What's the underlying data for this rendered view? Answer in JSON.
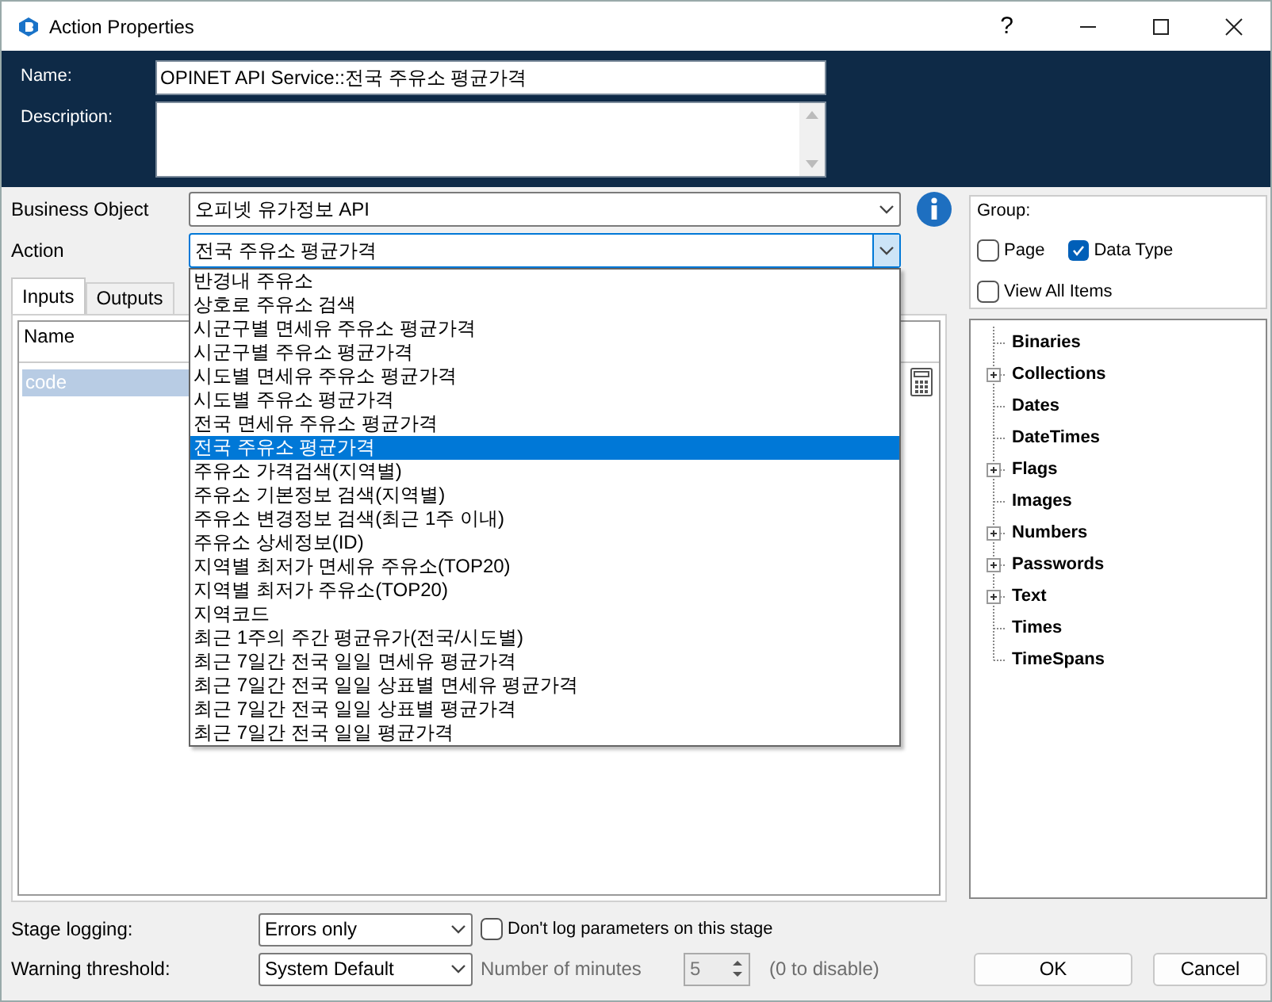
{
  "window": {
    "title": "Action Properties",
    "help": "?"
  },
  "header": {
    "name_label": "Name:",
    "name_value": "OPINET API Service::전국 주유소 평균가격",
    "description_label": "Description:"
  },
  "business_object": {
    "label": "Business Object",
    "value": "오피넷 유가정보 API"
  },
  "action": {
    "label": "Action",
    "value": "전국 주유소 평균가격",
    "expanded": true,
    "options": [
      {
        "label": "반경내 주유소",
        "selected": false
      },
      {
        "label": "상호로 주유소 검색",
        "selected": false
      },
      {
        "label": "시군구별 면세유 주유소 평균가격",
        "selected": false
      },
      {
        "label": "시군구별 주유소 평균가격",
        "selected": false
      },
      {
        "label": "시도별 면세유 주유소 평균가격",
        "selected": false
      },
      {
        "label": "시도별 주유소 평균가격",
        "selected": false
      },
      {
        "label": "전국 면세유 주유소 평균가격",
        "selected": false
      },
      {
        "label": "전국 주유소 평균가격",
        "selected": true
      },
      {
        "label": "주유소 가격검색(지역별)",
        "selected": false
      },
      {
        "label": "주유소 기본정보 검색(지역별)",
        "selected": false
      },
      {
        "label": "주유소 변경정보 검색(최근 1주 이내)",
        "selected": false
      },
      {
        "label": "주유소 상세정보(ID)",
        "selected": false
      },
      {
        "label": "지역별 최저가 면세유 주유소(TOP20)",
        "selected": false
      },
      {
        "label": "지역별 최저가 주유소(TOP20)",
        "selected": false
      },
      {
        "label": "지역코드",
        "selected": false
      },
      {
        "label": "최근 1주의 주간 평균유가(전국/시도별)",
        "selected": false
      },
      {
        "label": "최근 7일간 전국 일일 면세유 평균가격",
        "selected": false
      },
      {
        "label": "최근 7일간 전국 일일 상표별 면세유 평균가격",
        "selected": false
      },
      {
        "label": "최근 7일간 전국 일일 상표별 평균가격",
        "selected": false
      },
      {
        "label": "최근 7일간 전국 일일 평균가격",
        "selected": false
      }
    ]
  },
  "tabs": [
    {
      "label": "Inputs",
      "selected": true
    },
    {
      "label": "Outputs",
      "selected": false
    }
  ],
  "inputs_grid": {
    "columns": [
      "Name"
    ],
    "rows": [
      {
        "name": "code",
        "selected": true
      }
    ]
  },
  "group": {
    "label": "Group:",
    "options": [
      {
        "label": "Page",
        "checked": false
      },
      {
        "label": "Data Type",
        "checked": true
      },
      {
        "label": "View All Items",
        "checked": false
      }
    ]
  },
  "data_tree": [
    {
      "label": "Binaries",
      "expandable": false
    },
    {
      "label": "Collections",
      "expandable": true
    },
    {
      "label": "Dates",
      "expandable": false
    },
    {
      "label": "DateTimes",
      "expandable": false
    },
    {
      "label": "Flags",
      "expandable": true
    },
    {
      "label": "Images",
      "expandable": false
    },
    {
      "label": "Numbers",
      "expandable": true
    },
    {
      "label": "Passwords",
      "expandable": true
    },
    {
      "label": "Text",
      "expandable": true
    },
    {
      "label": "Times",
      "expandable": false
    },
    {
      "label": "TimeSpans",
      "expandable": false
    }
  ],
  "stage_logging": {
    "label": "Stage logging:",
    "value": "Errors only",
    "option_label": "Don't log parameters on this stage",
    "checked": false
  },
  "warning_threshold": {
    "label": "Warning threshold:",
    "value": "System Default",
    "minutes_label": "Number of minutes",
    "minutes_value": "5",
    "disabled": true,
    "hint": "(0 to disable)"
  },
  "buttons": [
    "OK",
    "Cancel"
  ]
}
